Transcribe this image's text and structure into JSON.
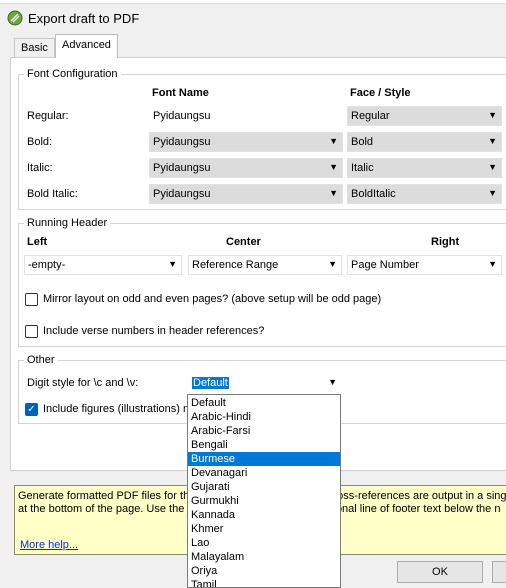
{
  "window": {
    "title": "Export draft to PDF"
  },
  "tabs": [
    {
      "label": "Basic"
    },
    {
      "label": "Advanced"
    }
  ],
  "font_config": {
    "legend": "Font Configuration",
    "col_font": "Font Name",
    "col_face": "Face / Style",
    "rows": [
      {
        "label": "Regular:",
        "font": "Pyidaungsu",
        "face": "Regular"
      },
      {
        "label": "Bold:",
        "font": "Pyidaungsu",
        "face": "Bold"
      },
      {
        "label": "Italic:",
        "font": "Pyidaungsu",
        "face": "Italic"
      },
      {
        "label": "Bold Italic:",
        "font": "Pyidaungsu",
        "face": "BoldItalic"
      }
    ]
  },
  "header": {
    "legend": "Running Header",
    "col_left": "Left",
    "col_center": "Center",
    "col_right": "Right",
    "left_value": "-empty-",
    "center_value": "Reference Range",
    "right_value": "Page Number",
    "mirror_label": "Mirror layout on odd and even pages? (above setup will be odd page)",
    "verse_label": "Include verse numbers in header references?"
  },
  "other": {
    "legend": "Other",
    "digit_label": "Digit style for \\c and \\v:",
    "digit_value": "Default",
    "figures_label": "Include figures (illustrations) m"
  },
  "dropdown": {
    "options": [
      "Default",
      "Arabic-Hindi",
      "Arabic-Farsi",
      "Bengali",
      "Burmese",
      "Devanagari",
      "Gujarati",
      "Gurmukhi",
      "Kannada",
      "Khmer",
      "Lao",
      "Malayalam",
      "Oriya",
      "Tamil"
    ],
    "selected": "Burmese"
  },
  "help": {
    "line1a": "Generate formatted PDF files for the",
    "line1b": "cross-references are output in a sing",
    "line2a": "at the bottom of the page. Use the D",
    "line2b": "itional line of footer text below the n",
    "more": "More help..."
  },
  "buttons": {
    "ok": "OK"
  },
  "colors": {
    "selection": "#0078d7",
    "help_bg": "#ffffc8",
    "checkbox": "#005fb8"
  }
}
